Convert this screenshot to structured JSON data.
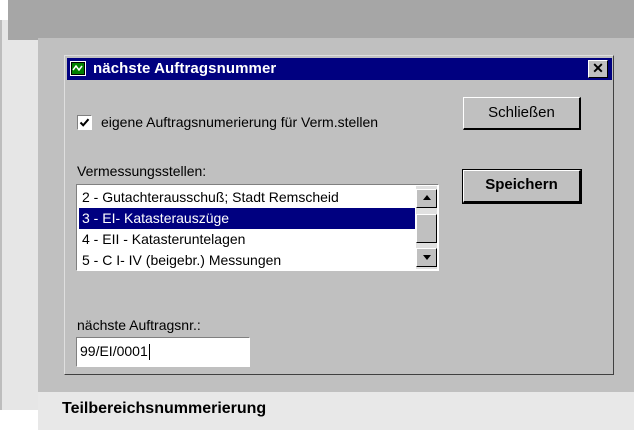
{
  "window": {
    "title": "nächste Auftragsnummer",
    "close_glyph": "✕"
  },
  "options": {
    "own_numbering_checked": true,
    "own_numbering_label": "eigene Auftragsnumerierung für Verm.stellen"
  },
  "buttons": {
    "close_label": "Schließen",
    "save_label": "Speichern"
  },
  "list": {
    "label": "Vermessungsstellen:",
    "items": [
      {
        "label": "2 - Gutachterausschuß; Stadt Remscheid",
        "selected": false
      },
      {
        "label": "3 - EI- Katasterauszüge",
        "selected": true
      },
      {
        "label": "4 - EII - Katasteruntelagen",
        "selected": false
      },
      {
        "label": "5 - C I- IV  (beigebr.) Messungen",
        "selected": false
      }
    ]
  },
  "next_number": {
    "label": "nächste Auftragsnr.:",
    "value": "99/EI/0001"
  },
  "caption": "Teilbereichsnummerierung",
  "colors": {
    "titlebar": "#000080",
    "selection": "#000080",
    "face": "#c0c0c0"
  }
}
